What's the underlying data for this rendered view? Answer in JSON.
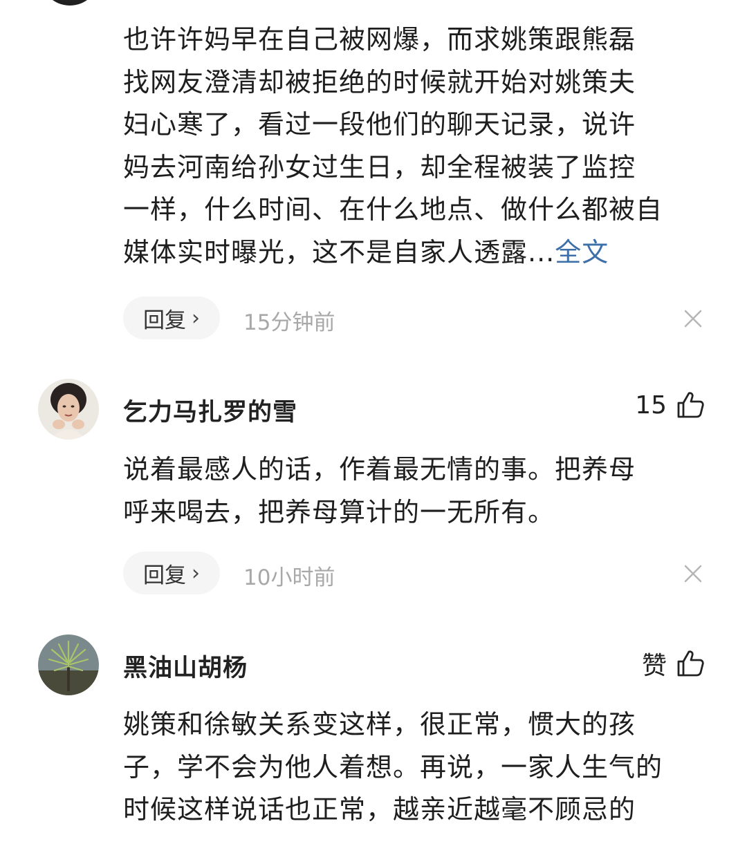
{
  "comments": [
    {
      "username": "",
      "likes": "",
      "lines": [
        "也许许妈早在自己被网爆，而求姚策跟熊磊",
        "找网友澄清却被拒绝的时候就开始对姚策夫",
        "妇心寒了，看过一段他们的聊天记录，说许",
        "妈去河南给孙女过生日，却全程被装了监控",
        "一样，什么时间、在什么地点、做什么都被自",
        "媒体实时曝光，这不是自家人透露..."
      ],
      "more_label": "全文",
      "reply_label": "回复",
      "timestamp": "15分钟前"
    },
    {
      "username": "乞力马扎罗的雪",
      "likes": "15",
      "lines": [
        "说着最感人的话，作着最无情的事。把养母",
        "呼来喝去，把养母算计的一无所有。"
      ],
      "reply_label": "回复",
      "timestamp": "10小时前"
    },
    {
      "username": "黑油山胡杨",
      "likes": "赞",
      "lines": [
        "姚策和徐敏关系变这样，很正常，惯大的孩",
        "子，学不会为他人着想。再说，一家人生气的",
        "时候这样说话也正常，越亲近越毫不顾忌的"
      ]
    }
  ],
  "icons": {
    "like": "thumbs-up-icon",
    "close": "close-icon",
    "reply_chevron": "chevron-right-icon"
  },
  "colors": {
    "link": "#3d6fa8",
    "timestamp": "#a8a8a8",
    "reply_bg": "#f5f5f5"
  }
}
